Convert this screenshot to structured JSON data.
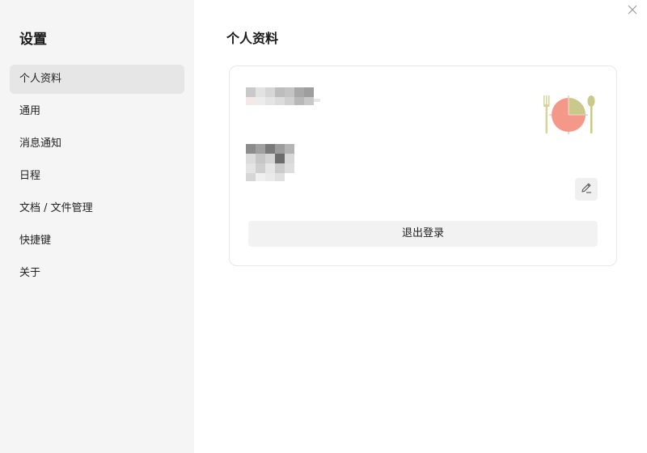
{
  "sidebar": {
    "title": "设置",
    "items": [
      {
        "label": "个人资料",
        "active": true
      },
      {
        "label": "通用"
      },
      {
        "label": "消息通知"
      },
      {
        "label": "日程"
      },
      {
        "label": "文档 / 文件管理"
      },
      {
        "label": "快捷键"
      },
      {
        "label": "关于"
      }
    ]
  },
  "main": {
    "title": "个人资料",
    "close_icon": "close-icon",
    "profile": {
      "avatar_icon": "plate-cutlery-avatar",
      "edit_icon": "pencil-icon",
      "logout_label": "退出登录"
    }
  },
  "colors": {
    "sidebar_bg": "#f5f5f5",
    "active_item_bg": "#e6e6e6",
    "button_bg": "#f2f2f2",
    "avatar_plate": "#f4998a",
    "avatar_accent": "#c9c98c"
  }
}
